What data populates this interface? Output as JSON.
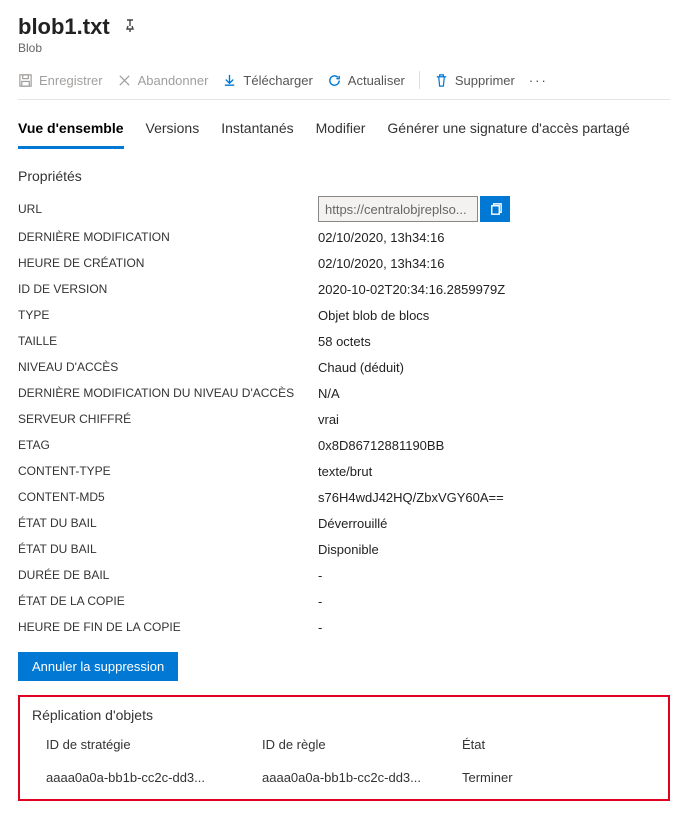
{
  "header": {
    "title": "blob1.txt",
    "subtitle": "Blob"
  },
  "toolbar": {
    "save": "Enregistrer",
    "discard": "Abandonner",
    "download": "Télécharger",
    "refresh": "Actualiser",
    "delete": "Supprimer"
  },
  "tabs": {
    "overview": "Vue d'ensemble",
    "versions": "Versions",
    "snapshots": "Instantanés",
    "edit": "Modifier",
    "sas": "Générer une signature d'accès partagé"
  },
  "sections": {
    "properties": "Propriétés",
    "replication": "Réplication d'objets"
  },
  "properties": {
    "url_label": "URL",
    "url_value": "https://centralobjreplso...",
    "last_modified_label": "DERNIÈRE MODIFICATION",
    "last_modified_value": "02/10/2020, 13h34:16",
    "creation_time_label": "HEURE DE CRÉATION",
    "creation_time_value": "02/10/2020, 13h34:16",
    "version_id_label": "ID DE VERSION",
    "version_id_value": "2020-10-02T20:34:16.2859979Z",
    "type_label": "TYPE",
    "type_value": "Objet blob de blocs",
    "size_label": "TAILLE",
    "size_value": "58 octets",
    "access_tier_label": "NIVEAU D'ACCÈS",
    "access_tier_value": "Chaud (déduit)",
    "access_tier_mod_label": "DERNIÈRE MODIFICATION DU NIVEAU D'ACCÈS",
    "access_tier_mod_value": "N/A",
    "server_encrypted_label": "SERVEUR CHIFFRÉ",
    "server_encrypted_value": "vrai",
    "etag_label": "ETAG",
    "etag_value": "0x8D86712881190BB",
    "content_type_label": "CONTENT-TYPE",
    "content_type_value": "texte/brut",
    "content_md5_label": "CONTENT-MD5",
    "content_md5_value": "s76H4wdJ42HQ/ZbxVGY60A==",
    "lease_status_label": "ÉTAT DU BAIL",
    "lease_status_value": "Déverrouillé",
    "lease_state_label": "ÉTAT DU BAIL",
    "lease_state_value": "Disponible",
    "lease_duration_label": "DURÉE DE BAIL",
    "lease_duration_value": "-",
    "copy_status_label": "ÉTAT DE LA COPIE",
    "copy_status_value": "-",
    "copy_completion_label": "HEURE DE FIN DE LA COPIE",
    "copy_completion_value": "-"
  },
  "actions": {
    "undelete": "Annuler la suppression"
  },
  "replication": {
    "headers": {
      "policy": "ID de stratégie",
      "rule": "ID de règle",
      "status": "État"
    },
    "rows": [
      {
        "policy": "aaaa0a0a-bb1b-cc2c-dd3...",
        "rule": "aaaa0a0a-bb1b-cc2c-dd3...",
        "status": "Terminer"
      }
    ]
  }
}
